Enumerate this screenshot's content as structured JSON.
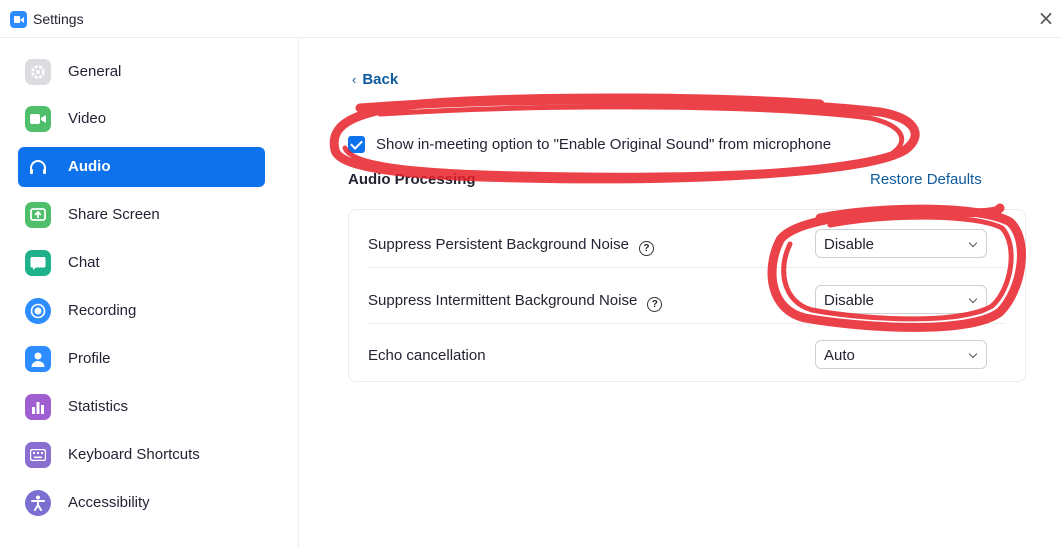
{
  "window": {
    "title": "Settings",
    "close": "×"
  },
  "sidebar": {
    "items": [
      {
        "label": "General",
        "icon": "gear-icon",
        "color": "#dcdce0",
        "active": false
      },
      {
        "label": "Video",
        "icon": "video-camera-icon",
        "color": "#4fbf6b",
        "active": false
      },
      {
        "label": "Audio",
        "icon": "headphones-icon",
        "color": "#0e72ed",
        "active": true
      },
      {
        "label": "Share Screen",
        "icon": "share-screen-icon",
        "color": "#4fbf6b",
        "active": false
      },
      {
        "label": "Chat",
        "icon": "chat-bubble-icon",
        "color": "#1fb28a",
        "active": false
      },
      {
        "label": "Recording",
        "icon": "record-icon",
        "color": "#2d8cff",
        "active": false
      },
      {
        "label": "Profile",
        "icon": "person-icon",
        "color": "#2d8cff",
        "active": false
      },
      {
        "label": "Statistics",
        "icon": "bar-chart-icon",
        "color": "#a05fd1",
        "active": false
      },
      {
        "label": "Keyboard Shortcuts",
        "icon": "keyboard-icon",
        "color": "#8a6fd1",
        "active": false
      },
      {
        "label": "Accessibility",
        "icon": "accessibility-icon",
        "color": "#7b6fd1",
        "active": false
      }
    ]
  },
  "main": {
    "back_label": "Back",
    "original_sound_checkbox": {
      "label": "Show in-meeting option to \"Enable Original Sound\" from microphone",
      "checked": true
    },
    "section_title": "Audio Processing",
    "restore_label": "Restore Defaults",
    "rows": [
      {
        "label": "Suppress Persistent Background Noise",
        "has_help": true,
        "value": "Disable"
      },
      {
        "label": "Suppress Intermittent Background Noise",
        "has_help": true,
        "value": "Disable"
      },
      {
        "label": "Echo cancellation",
        "has_help": false,
        "value": "Auto"
      }
    ]
  },
  "colors": {
    "accent": "#0e72ed",
    "link": "#0e5a9e",
    "annotation": "#e8202a"
  }
}
